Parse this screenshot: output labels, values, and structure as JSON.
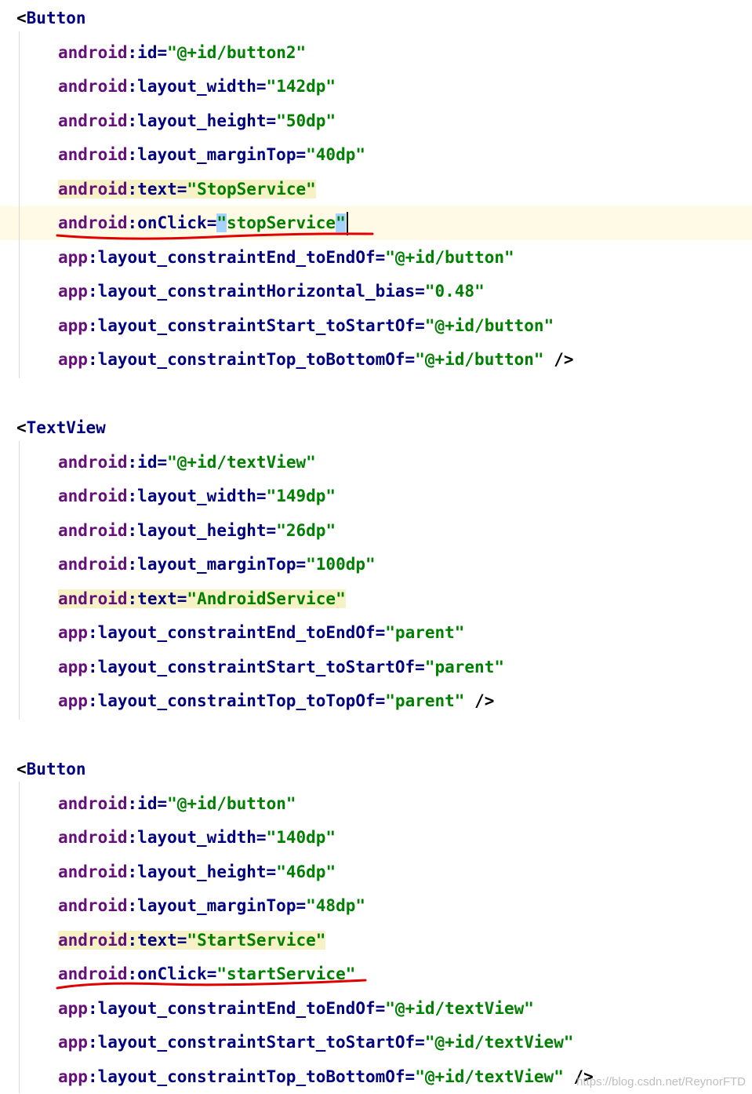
{
  "editor": {
    "blocks": [
      {
        "tag": "Button",
        "attributes": [
          {
            "ns": "android",
            "name": "id",
            "value": "@+id/button2"
          },
          {
            "ns": "android",
            "name": "layout_width",
            "value": "142dp"
          },
          {
            "ns": "android",
            "name": "layout_height",
            "value": "50dp"
          },
          {
            "ns": "android",
            "name": "layout_marginTop",
            "value": "40dp"
          },
          {
            "ns": "android",
            "name": "text",
            "value": "StopService"
          },
          {
            "ns": "android",
            "name": "onClick",
            "value": "stopService"
          },
          {
            "ns": "app",
            "name": "layout_constraintEnd_toEndOf",
            "value": "@+id/button"
          },
          {
            "ns": "app",
            "name": "layout_constraintHorizontal_bias",
            "value": "0.48"
          },
          {
            "ns": "app",
            "name": "layout_constraintStart_toStartOf",
            "value": "@+id/button"
          },
          {
            "ns": "app",
            "name": "layout_constraintTop_toBottomOf",
            "value": "@+id/button",
            "close": "/>"
          }
        ]
      },
      {
        "tag": "TextView",
        "attributes": [
          {
            "ns": "android",
            "name": "id",
            "value": "@+id/textView"
          },
          {
            "ns": "android",
            "name": "layout_width",
            "value": "149dp"
          },
          {
            "ns": "android",
            "name": "layout_height",
            "value": "26dp"
          },
          {
            "ns": "android",
            "name": "layout_marginTop",
            "value": "100dp"
          },
          {
            "ns": "android",
            "name": "text",
            "value": "AndroidService"
          },
          {
            "ns": "app",
            "name": "layout_constraintEnd_toEndOf",
            "value": "parent"
          },
          {
            "ns": "app",
            "name": "layout_constraintStart_toStartOf",
            "value": "parent"
          },
          {
            "ns": "app",
            "name": "layout_constraintTop_toTopOf",
            "value": "parent",
            "close": "/>"
          }
        ]
      },
      {
        "tag": "Button",
        "attributes": [
          {
            "ns": "android",
            "name": "id",
            "value": "@+id/button"
          },
          {
            "ns": "android",
            "name": "layout_width",
            "value": "140dp"
          },
          {
            "ns": "android",
            "name": "layout_height",
            "value": "46dp"
          },
          {
            "ns": "android",
            "name": "layout_marginTop",
            "value": "48dp"
          },
          {
            "ns": "android",
            "name": "text",
            "value": "StartService"
          },
          {
            "ns": "android",
            "name": "onClick",
            "value": "startService"
          },
          {
            "ns": "app",
            "name": "layout_constraintEnd_toEndOf",
            "value": "@+id/textView"
          },
          {
            "ns": "app",
            "name": "layout_constraintStart_toStartOf",
            "value": "@+id/textView"
          },
          {
            "ns": "app",
            "name": "layout_constraintTop_toBottomOf",
            "value": "@+id/textView",
            "close": "/>"
          }
        ]
      }
    ]
  },
  "watermark": "https://blog.csdn.net/ReynorFTD",
  "colors": {
    "tag": "#000080",
    "namespace": "#660e7a",
    "attribute": "#000080",
    "value": "#008000",
    "text_attr_highlight": "#f7f2c6",
    "caret_line": "#fffae6",
    "annotation_underline": "#e00000",
    "quote_selection": "#a6d2ff"
  }
}
